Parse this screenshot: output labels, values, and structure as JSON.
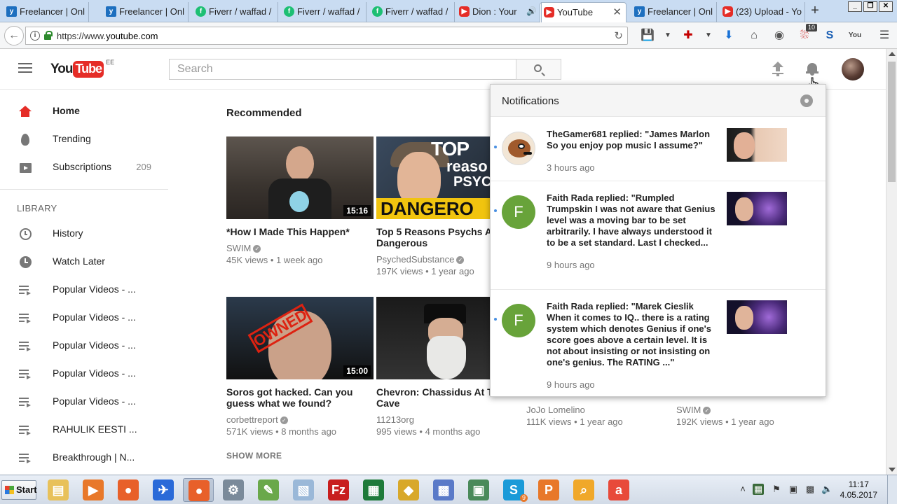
{
  "browser": {
    "tabs": [
      {
        "label": "Freelancer | Onl",
        "icon": "twitter-icon",
        "kind": "tw"
      },
      {
        "label": "Freelancer | Onl",
        "icon": "twitter-icon",
        "kind": "tw"
      },
      {
        "label": "Fiverr / waffad /",
        "icon": "fiverr-icon",
        "kind": "fv"
      },
      {
        "label": "Fiverr / waffad /",
        "icon": "fiverr-icon",
        "kind": "fv"
      },
      {
        "label": "Fiverr / waffad /",
        "icon": "fiverr-icon",
        "kind": "fv"
      },
      {
        "label": "Dion : Your",
        "icon": "youtube-icon",
        "kind": "yt",
        "audio": true
      },
      {
        "label": "YouTube",
        "icon": "youtube-icon",
        "kind": "yt",
        "active": true
      },
      {
        "label": "Freelancer | Onl",
        "icon": "twitter-icon",
        "kind": "tw"
      },
      {
        "label": "(23) Upload - Yo",
        "icon": "youtube-icon",
        "kind": "yt"
      }
    ],
    "new_tab": "+",
    "url_prefix": "https://www.",
    "url_host": "youtube.com",
    "extension_badge": "10"
  },
  "youtube": {
    "logo_you": "You",
    "logo_tube": "Tube",
    "country_code": "EE",
    "search_placeholder": "Search"
  },
  "sidebar": {
    "items": [
      {
        "label": "Home",
        "icon": "home-icon",
        "active": true
      },
      {
        "label": "Trending",
        "icon": "flame-icon"
      },
      {
        "label": "Subscriptions",
        "icon": "subscriptions-icon",
        "count": "209"
      }
    ],
    "library_heading": "LIBRARY",
    "library": [
      {
        "label": "History",
        "icon": "history-icon"
      },
      {
        "label": "Watch Later",
        "icon": "clock-icon"
      },
      {
        "label": "Popular Videos - ...",
        "icon": "playlist-icon"
      },
      {
        "label": "Popular Videos - ...",
        "icon": "playlist-icon"
      },
      {
        "label": "Popular Videos - ...",
        "icon": "playlist-icon"
      },
      {
        "label": "Popular Videos - ...",
        "icon": "playlist-icon"
      },
      {
        "label": "Popular Videos - ...",
        "icon": "playlist-icon"
      },
      {
        "label": "RAHULIK EESTI ...",
        "icon": "playlist-icon"
      },
      {
        "label": "Breakthrough | N...",
        "icon": "playlist-icon"
      }
    ]
  },
  "main": {
    "section_title": "Recommended",
    "videos": [
      {
        "title": "*How I Made This Happen*",
        "channel": "SWIM",
        "verified": true,
        "meta": "45K views • 1 week ago",
        "duration": "15:16",
        "thumb": "swim"
      },
      {
        "title": "Top 5 Reasons Psychs Are Dangerous",
        "channel": "PsychedSubstance",
        "verified": true,
        "meta": "197K views • 1 year ago",
        "duration": "",
        "thumb": "psy",
        "thumb_text": [
          "TOP",
          "reaso",
          "PSYC",
          "DANGERO"
        ]
      },
      {
        "title": "Soros got hacked. Can you guess what we found?",
        "channel": "corbettreport",
        "verified": true,
        "meta": "571K views • 8 months ago",
        "duration": "15:00",
        "thumb": "soros",
        "thumb_text": [
          "OWNED"
        ]
      },
      {
        "title": "Chevron: Chassidus At The Cave",
        "channel": "11213org",
        "verified": false,
        "meta": "995 views • 4 months ago",
        "duration": "",
        "thumb": "chev"
      }
    ],
    "peek": [
      {
        "channel": "JoJo Lomelino",
        "meta": "111K views • 1 year ago"
      },
      {
        "channel": "SWIM",
        "meta": "192K views • 1 year ago"
      }
    ],
    "show_more": "SHOW MORE"
  },
  "notifications": {
    "title": "Notifications",
    "items": [
      {
        "text": "TheGamer681 replied: \"James Marlon So you enjoy pop music I assume?\"",
        "time": "3 hours ago",
        "avatar": "cartoon",
        "thumb": "kiss"
      },
      {
        "text": "Faith Rada replied: \"Rumpled Trumpskin I was not aware that Genius level was a moving bar to be set arbitrarily. I have always understood it to be a set standard. Last I checked... the threshold for",
        "time": "9 hours ago",
        "avatar": "F",
        "thumb": "boy"
      },
      {
        "text": "Faith Rada replied: \"Marek Cieslik When it comes to IQ.. there is a rating system which denotes Genius if one's score goes above a certain level. It is not about insisting or not insisting on one's genius. The RATING ...\"",
        "time": "9 hours ago",
        "avatar": "F",
        "thumb": "boy"
      }
    ]
  },
  "taskbar": {
    "start_label": "Start",
    "clock_time": "11:17",
    "clock_date": "4.05.2017",
    "skype_badge": "9"
  }
}
